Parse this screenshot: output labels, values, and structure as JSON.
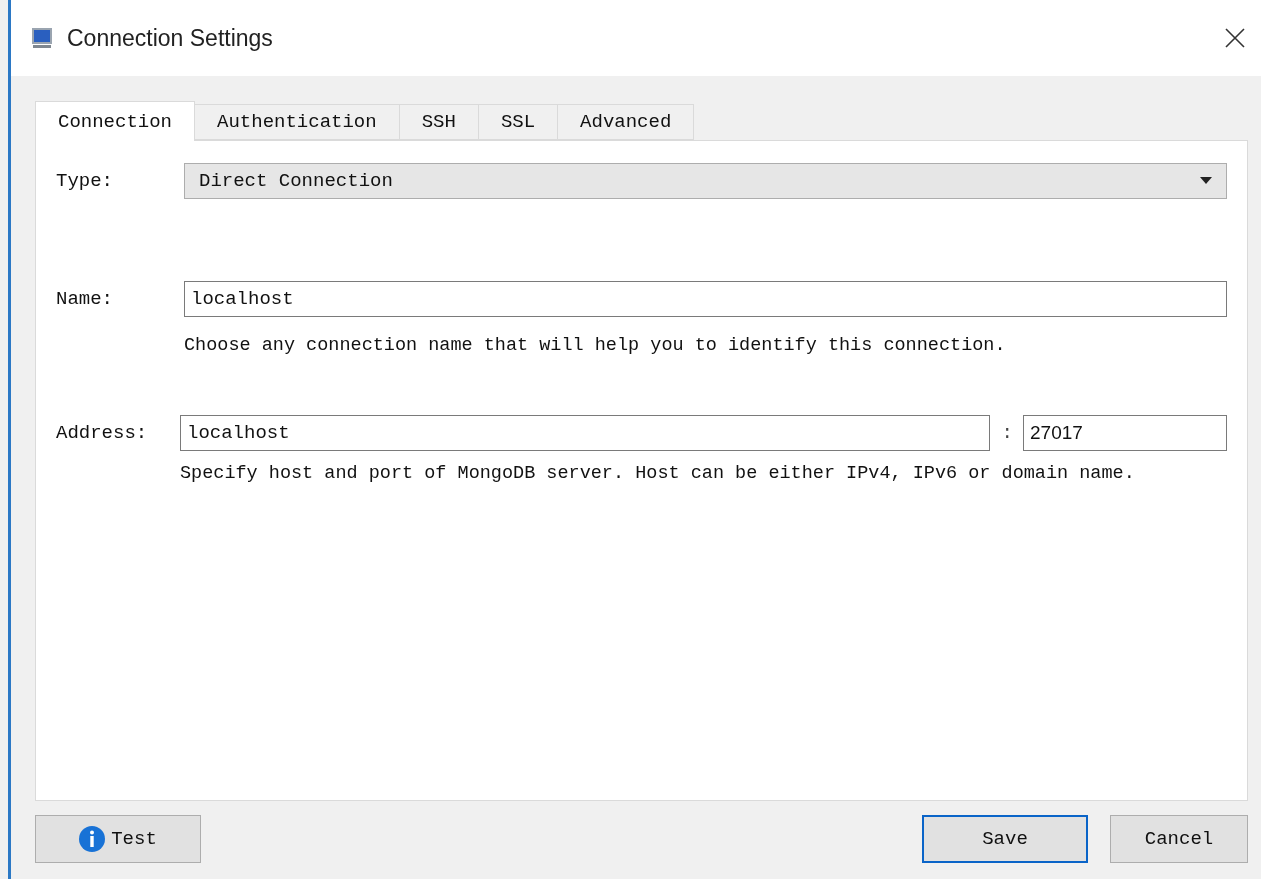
{
  "window": {
    "title": "Connection Settings"
  },
  "tabs": [
    {
      "label": "Connection",
      "selected": true
    },
    {
      "label": "Authentication",
      "selected": false
    },
    {
      "label": "SSH",
      "selected": false
    },
    {
      "label": "SSL",
      "selected": false
    },
    {
      "label": "Advanced",
      "selected": false
    }
  ],
  "type": {
    "label": "Type:",
    "value": "Direct Connection"
  },
  "name": {
    "label": "Name:",
    "value": "localhost",
    "hint": "Choose any connection name that will help you to identify this connection."
  },
  "address": {
    "label": "Address:",
    "host": "localhost",
    "separator": ":",
    "port": "27017",
    "hint": "Specify host and port of MongoDB server. Host can be either IPv4, IPv6 or domain name."
  },
  "buttons": [
    {
      "label": "Test",
      "kind": "info",
      "default": false
    },
    {
      "label": "Save",
      "kind": "plain",
      "default": true
    },
    {
      "label": "Cancel",
      "kind": "plain",
      "default": false
    }
  ]
}
